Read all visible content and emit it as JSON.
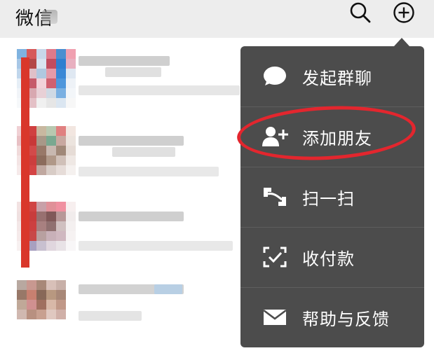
{
  "header": {
    "title": "微信",
    "search_icon": "search-icon",
    "add_icon": "plus-circle-icon"
  },
  "popup_menu": {
    "items": [
      {
        "label": "发起群聊",
        "icon": "chat-bubble-icon"
      },
      {
        "label": "添加朋友",
        "icon": "add-friend-icon"
      },
      {
        "label": "扫一扫",
        "icon": "scan-icon"
      },
      {
        "label": "收付款",
        "icon": "payment-icon"
      },
      {
        "label": "帮助与反馈",
        "icon": "envelope-icon"
      }
    ]
  },
  "annotation": {
    "color": "#e3262e"
  },
  "colors": {
    "header_bg": "#ededed",
    "popup_bg": "#4c4c4c",
    "highlight": "#e3262e"
  }
}
